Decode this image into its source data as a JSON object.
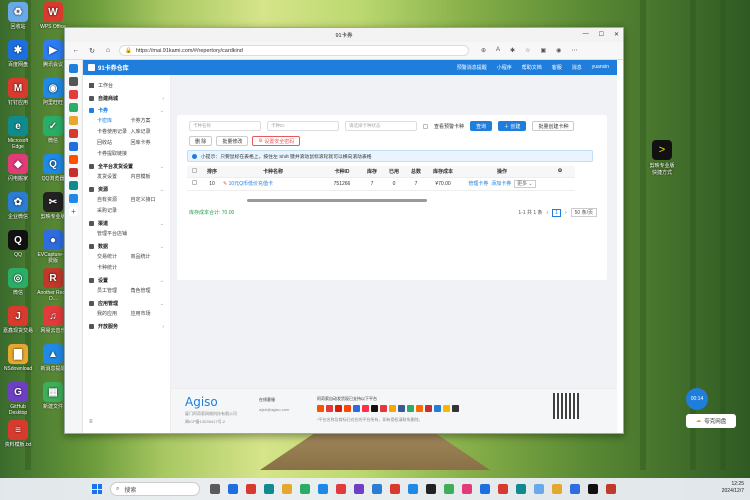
{
  "desktop": {
    "icons_left": [
      {
        "label": "回收站",
        "color": "#6aa9e9",
        "glyph": "♻"
      },
      {
        "label": "WPS Office",
        "color": "#d83a2e",
        "glyph": "W"
      },
      {
        "label": "百度网盘",
        "color": "#1d6fe0",
        "glyph": "✱"
      },
      {
        "label": "腾讯会议",
        "color": "#2d7cf6",
        "glyph": "▶"
      },
      {
        "label": "钉钉应用",
        "color": "#d83a2e",
        "glyph": "M"
      },
      {
        "label": "阿里旺旺",
        "color": "#1f89e5",
        "glyph": "◉"
      },
      {
        "label": "Microsoft Edge",
        "color": "#0f8b8d",
        "glyph": "e"
      },
      {
        "label": "微信",
        "color": "#2aae67",
        "glyph": "✓"
      },
      {
        "label": "闪电搬家",
        "color": "#e23b7a",
        "glyph": "◆"
      },
      {
        "label": "QQ浏览器",
        "color": "#1f89e5",
        "glyph": "Q"
      },
      {
        "label": "企业微信",
        "color": "#2b7cd3",
        "glyph": "✿"
      },
      {
        "label": "剪映专业版",
        "color": "#222222",
        "glyph": "✂"
      },
      {
        "label": "QQ",
        "color": "#111111",
        "glyph": "Q"
      },
      {
        "label": "EVCapture-免费版",
        "color": "#2f6cdf",
        "glyph": "●"
      },
      {
        "label": "微信",
        "color": "#2aae67",
        "glyph": "◎"
      },
      {
        "label": "Another Redis D...",
        "color": "#c0392b",
        "glyph": "R"
      },
      {
        "label": "嘉鑫现货交易",
        "color": "#d83a2e",
        "glyph": "J"
      },
      {
        "label": "网易云音乐",
        "color": "#e23b3b",
        "glyph": "♫"
      },
      {
        "label": "NSdownload",
        "color": "#e6a72f",
        "glyph": "▇"
      },
      {
        "label": "新消息提醒",
        "color": "#1f89e5",
        "glyph": "▲"
      },
      {
        "label": "GitHub Desktop",
        "color": "#6e3fc4",
        "glyph": "G"
      },
      {
        "label": "新建文件",
        "color": "#3fae5a",
        "glyph": "▦"
      },
      {
        "label": "资料模板.txt",
        "color": "#d83a2e",
        "glyph": "≡"
      }
    ],
    "icons_right": [
      {
        "label": "剪映专业版快捷方式",
        "color": "#222222",
        "glyph": ">"
      }
    ],
    "side_timer": "00:14",
    "cloud_label": "夸克网盘"
  },
  "browser": {
    "tab_title": "91卡券",
    "url": "https://mai.91kami.com/#/repertory/cardkind",
    "window_controls": [
      "—",
      "☐",
      "✕"
    ]
  },
  "app": {
    "brand": "91卡券仓库",
    "topnav": [
      "预警消息提醒",
      "小程序",
      "帮助文档",
      "客服",
      "消息",
      "yuanxin"
    ],
    "sidebar": {
      "top_item": "工作台",
      "sections": [
        {
          "title": "自建商城",
          "items": []
        },
        {
          "title": "卡券",
          "items": [
            "卡密库",
            "卡券方案",
            "卡卷使用记录",
            "入库记录",
            "回收站",
            "回库卡券",
            "卡券提取链接"
          ],
          "active": true
        },
        {
          "title": "全平台发货设置",
          "items": [
            "发货设置",
            "内容模板"
          ]
        },
        {
          "title": "资源",
          "items": [
            "自有资源",
            "自定义接口",
            "采购记录"
          ]
        },
        {
          "title": "渠道",
          "items": [
            "管理平台店铺"
          ]
        },
        {
          "title": "数据",
          "items": [
            "交易统计",
            "商品统计",
            "卡种统计"
          ]
        },
        {
          "title": "设置",
          "items": [
            "员工管理",
            "角色管理"
          ]
        },
        {
          "title": "应用管理",
          "items": [
            "我的应用",
            "应用市场"
          ]
        },
        {
          "title": "开放服务",
          "items": []
        }
      ]
    },
    "filters": {
      "card_name_placeholder": "卡种名称",
      "card_id_placeholder": "卡种ID",
      "type_placeholder": "请选择卡种状态",
      "show_warn_label": "查看预警卡种",
      "query_btn": "查询",
      "create_btn": "创建",
      "batch_create_btn": "批量创建卡种"
    },
    "actions": {
      "delete_btn": "删 除",
      "batch_edit_btn": "批量修改",
      "security_btn": "设置安全密码"
    },
    "tip": "小提示：只要鼠标在表格上，按住左 Shift 键并滚动鼠标滚轮就可以横向滚动表格",
    "table": {
      "headers": [
        "排序",
        "卡种名称",
        "卡种ID",
        "库存",
        "已用",
        "总数",
        "库存成本",
        "操作"
      ],
      "rows": [
        {
          "sort": "10",
          "name": "10元Q币低价充值卡",
          "id": "751266",
          "stock": "7",
          "used": "0",
          "total": "7",
          "cost": "¥70.00",
          "op1": "管理卡券",
          "op2": "添加卡券",
          "more": "更多"
        }
      ]
    },
    "total_cost": "库存成本合计: 70.00",
    "pager": {
      "summary": "1-1 共 1 条",
      "page": "1",
      "size": "50 条/页"
    }
  },
  "footer": {
    "brand": "Agiso",
    "company": "厦门阿奇索网络科技有限公司",
    "icp": "闽ICP备13039417号-2",
    "contact_title": "在线客服",
    "email": "wjsh@agiso.com",
    "platforms_title": "阿奇索自动发货现已支持以下平台",
    "platforms_note": "*平台名称及商标归对应的平台所有，如有侵权请联系删除。",
    "platform_colors": [
      "#ff5000",
      "#e4393c",
      "#d81e06",
      "#ff4400",
      "#2d6be4",
      "#ff2e4d",
      "#111111",
      "#e4393c",
      "#f7a600",
      "#3b5998",
      "#2aae67",
      "#ff6a00",
      "#c62f2f",
      "#1f7edc",
      "#ffb400",
      "#333333"
    ]
  },
  "taskbar": {
    "search_placeholder": "搜索",
    "time": "12:25",
    "date": "2024/12/7",
    "app_colors": [
      "#5a5a5a",
      "#1d6fe0",
      "#d83a2e",
      "#0f8b8d",
      "#e6a72f",
      "#2aae67",
      "#1f89e5",
      "#e23b3b",
      "#6e3fc4",
      "#2b7cd3",
      "#d83a2e",
      "#1f89e5",
      "#222222",
      "#3fae5a",
      "#e23b7a",
      "#1d6fe0",
      "#d83a2e",
      "#0f8b8d",
      "#6aa9e9",
      "#e6a72f",
      "#2f6cdf",
      "#111111",
      "#c0392b"
    ]
  }
}
